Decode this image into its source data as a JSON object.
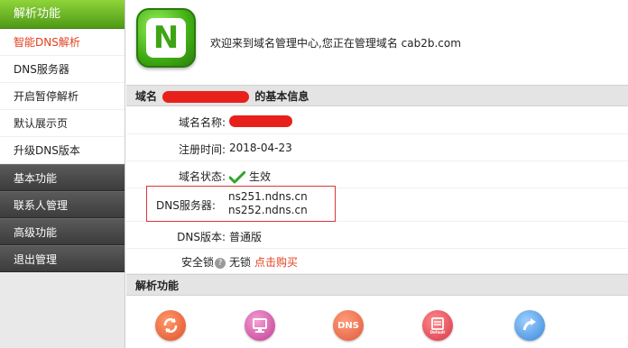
{
  "sidebar": {
    "section_title": "解析功能",
    "items": [
      {
        "label": "智能DNS解析",
        "active": true
      },
      {
        "label": "DNS服务器",
        "active": false
      },
      {
        "label": "开启暂停解析",
        "active": false
      },
      {
        "label": "默认展示页",
        "active": false
      },
      {
        "label": "升级DNS版本",
        "active": false
      }
    ],
    "groups": [
      "基本功能",
      "联系人管理",
      "高级功能",
      "退出管理"
    ]
  },
  "welcome": {
    "logo_icon": "n-logo-icon",
    "text": "欢迎来到域名管理中心,您正在管理域名 cab2b.com"
  },
  "info_section": {
    "title_prefix": "域名",
    "title_suffix": "的基本信息",
    "rows": {
      "name_label": "域名名称:",
      "date_label": "注册时间:",
      "date_value": "2018-04-23",
      "status_label": "域名状态:",
      "status_value": "生效",
      "dns_label": "DNS服务器:",
      "dns_values": [
        "ns251.ndns.cn",
        "ns252.ndns.cn"
      ],
      "version_label": "DNS版本:",
      "version_value": "普通版",
      "lock_label": "安全锁",
      "lock_value": "无锁",
      "lock_buy": "点击购买"
    }
  },
  "func_section": {
    "title": "解析功能",
    "icons": [
      "refresh-icon",
      "monitor-icon",
      "dns-icon",
      "default-page-icon",
      "upgrade-icon"
    ],
    "icon_text": {
      "dns": "DNS",
      "default": "Default"
    }
  },
  "colors": {
    "accent_green": "#4f9a16",
    "active_red": "#e2401c",
    "highlight_box": "#d9363a"
  }
}
